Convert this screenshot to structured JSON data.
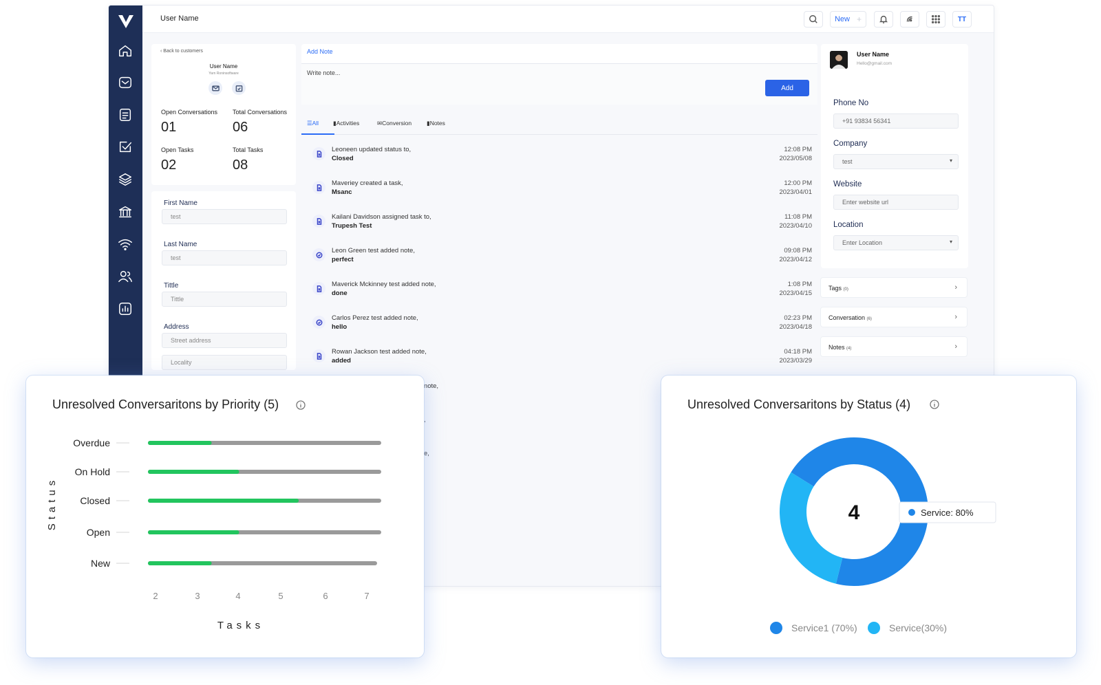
{
  "topbar": {
    "user_name": "User Name",
    "new_label": "New",
    "plus": "+",
    "initials": "TT"
  },
  "sidebar": {
    "items": [
      "home-icon",
      "inbox-icon",
      "document-icon",
      "checkbox-icon",
      "layers-icon",
      "bank-icon",
      "wifi-icon",
      "contacts-icon",
      "report-icon"
    ]
  },
  "profile": {
    "back_label": "Back to customers",
    "name": "User Name",
    "subtitle": "Yarn   Roninsoftware",
    "stats": [
      {
        "label": "Open Conversations",
        "value": "01"
      },
      {
        "label": "Total Conversations",
        "value": "06"
      },
      {
        "label": "Open Tasks",
        "value": "02"
      },
      {
        "label": "Total Tasks",
        "value": "08"
      }
    ]
  },
  "form": {
    "fields": [
      {
        "label": "First Name",
        "value": "test"
      },
      {
        "label": "Last Name",
        "value": "test"
      },
      {
        "label": "Tittle",
        "value": "Tittle"
      },
      {
        "label": "Address",
        "value": "Street address"
      }
    ],
    "locality_placeholder": "Locality"
  },
  "notes": {
    "tab_label": "Add Note",
    "placeholder": "Write note...",
    "add_label": "Add",
    "tabs": [
      "All",
      "Activities",
      "Conversion",
      "Notes"
    ]
  },
  "activities": [
    {
      "text": "Leoneen updated status to,",
      "detail": "Closed",
      "time": "12:08 PM",
      "date": "2023/05/08",
      "icon": "document-icon"
    },
    {
      "text": "Maveriey created a task,",
      "detail": "Msanc",
      "time": "12:00 PM",
      "date": "2023/04/01",
      "icon": "document-icon"
    },
    {
      "text": "Kailani Davidson assigned task to,",
      "detail": "Trupesh Test",
      "time": "11:08 PM",
      "date": "2023/04/10",
      "icon": "document-icon"
    },
    {
      "text": "Leon Green test added note,",
      "detail": "perfect",
      "time": "09:08 PM",
      "date": "2023/04/12",
      "icon": "check-circle-icon"
    },
    {
      "text": "Maverick Mckinney test added note,",
      "detail": "done",
      "time": "1:08 PM",
      "date": "2023/04/15",
      "icon": "document-icon"
    },
    {
      "text": "Carlos Perez test added note,",
      "detail": "hello",
      "time": "02:23 PM",
      "date": "2023/04/18",
      "icon": "check-circle-icon"
    },
    {
      "text": "Rowan Jackson test added note,",
      "detail": "added",
      "time": "04:18 PM",
      "date": "2023/03/29",
      "icon": "document-icon"
    }
  ],
  "hidden_fragments": [
    "d note,",
    "te,",
    "ote,",
    "e,"
  ],
  "contact": {
    "name": "User Name",
    "email": "Hello@gmail.com",
    "phone_label": "Phone No",
    "phone_value": "+91 93834 56341",
    "company_label": "Company",
    "company_value": "test",
    "website_label": "Website",
    "website_placeholder": "Enter website url",
    "location_label": "Location",
    "location_placeholder": "Enter Location"
  },
  "accordions": [
    {
      "label": "Tags",
      "count": "(0)"
    },
    {
      "label": "Conversation",
      "count": "(6)"
    },
    {
      "label": "Notes",
      "count": "(4)"
    }
  ],
  "colors": {
    "sidebar": "#1e2f57",
    "accent": "#2b6cf6",
    "bar_fill": "#22c55e",
    "bar_track": "#9a9a9a",
    "donut_main": "#1f86e8",
    "donut_light": "#22b5f5"
  },
  "chart_data": [
    {
      "type": "bar",
      "orientation": "horizontal",
      "title": "Unresolved Conversaritons by Priority (5)",
      "xlabel": "Tasks",
      "ylabel": "Status",
      "categories": [
        "Overdue",
        "On Hold",
        "Closed",
        "Open",
        "New"
      ],
      "values": [
        3.3,
        3.9,
        5.2,
        3.9,
        3.3
      ],
      "max": 7,
      "x_ticks": [
        "2",
        "3",
        "4",
        "5",
        "6",
        "7"
      ],
      "xlim": [
        2,
        7
      ]
    },
    {
      "type": "pie",
      "variant": "donut",
      "title": "Unresolved Conversaritons by Status (4)",
      "center_label": "4",
      "tooltip": "Service: 80%",
      "series": [
        {
          "name": "Service1 (70%)",
          "value": 70
        },
        {
          "name": "Service(30%)",
          "value": 30
        }
      ]
    }
  ]
}
